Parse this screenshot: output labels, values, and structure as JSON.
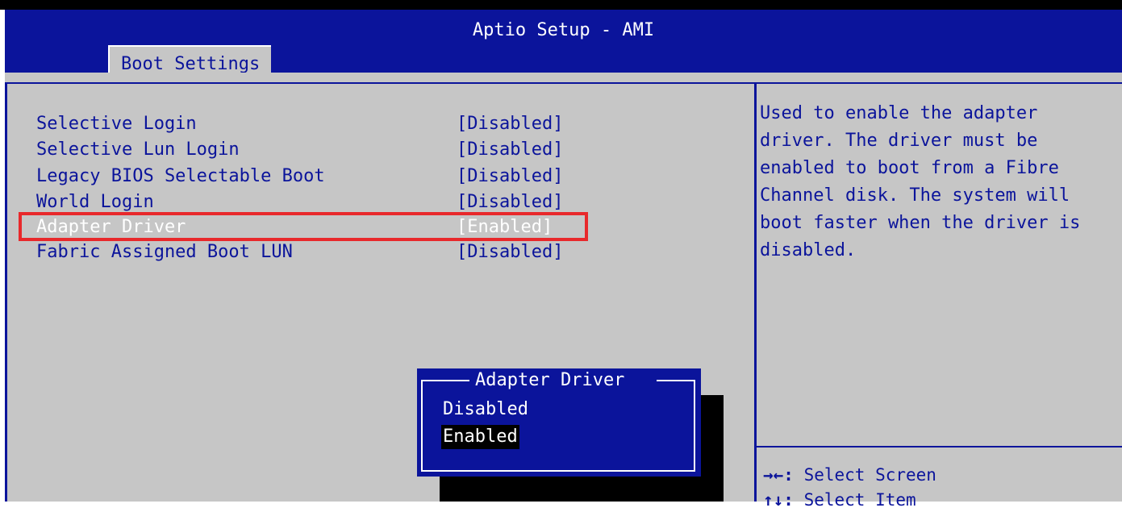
{
  "app": {
    "title": "Aptio Setup - AMI"
  },
  "tabs": [
    {
      "label": "Boot Settings"
    }
  ],
  "settings": [
    {
      "label": "Selective Login",
      "value": "[Disabled]"
    },
    {
      "label": "Selective Lun Login",
      "value": "[Disabled]"
    },
    {
      "label": "Legacy BIOS Selectable Boot",
      "value": "[Disabled]"
    },
    {
      "label": "World Login",
      "value": "[Disabled]"
    },
    {
      "label": "Adapter Driver",
      "value": "[Enabled]"
    },
    {
      "label": "Fabric Assigned Boot LUN",
      "value": "[Disabled]"
    }
  ],
  "help": {
    "text": "Used to enable the adapter\ndriver. The driver must be\nenabled to boot from a Fibre\nChannel disk. The system will\nboot faster when the driver is\ndisabled.",
    "keys": [
      {
        "key": "→←:",
        "action": " Select Screen"
      },
      {
        "key": "↑↓:",
        "action": " Select Item"
      }
    ]
  },
  "popup": {
    "title": "Adapter Driver",
    "options": [
      "Disabled",
      "Enabled"
    ],
    "selected": "Enabled"
  },
  "colors": {
    "background": "#c6c6c6",
    "accent": "#0b149b",
    "highlight_frame": "#e8282b",
    "selected_text": "#ffffff"
  }
}
